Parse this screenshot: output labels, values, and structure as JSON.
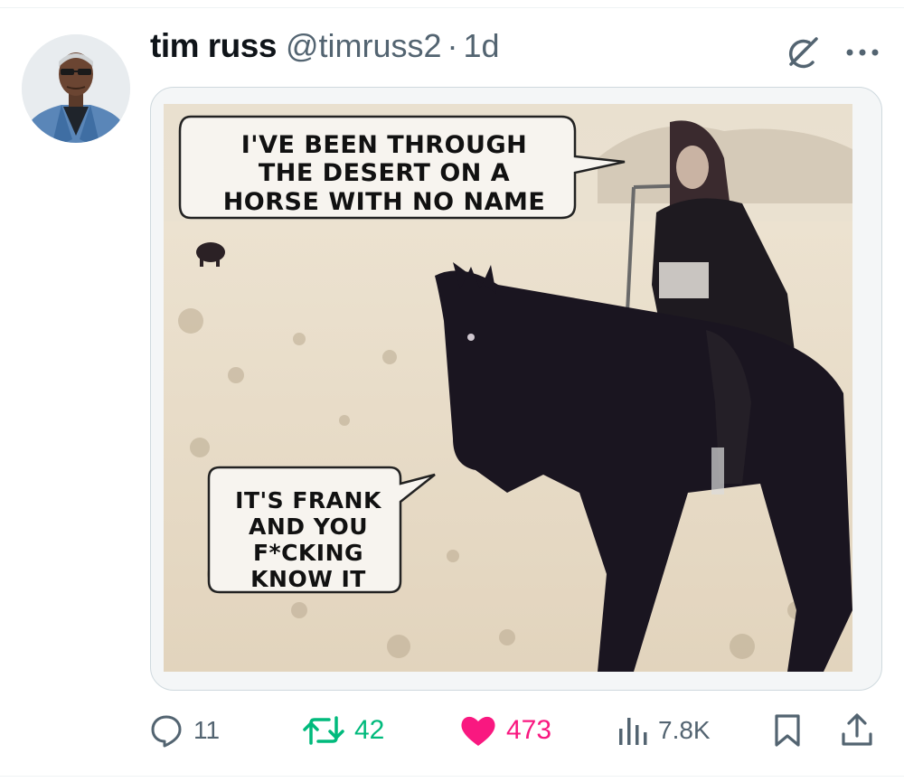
{
  "tweet": {
    "display_name": "tim russ",
    "handle": "@timruss2",
    "separator": "·",
    "time": "1d",
    "media": {
      "bubble_top_lines": [
        "I'VE BEEN THROUGH",
        "THE DESERT ON A",
        "HORSE WITH NO NAME"
      ],
      "bubble_bottom_lines": [
        "IT'S FRANK",
        "AND YOU",
        "F*CKING",
        "KNOW IT"
      ]
    }
  },
  "actions": {
    "reply_count": "11",
    "repost_count": "42",
    "like_count": "473",
    "views_count": "7.8K"
  },
  "colors": {
    "repost_green": "#00ba7c",
    "like_pink": "#f91880",
    "muted_gray": "#536471",
    "text_dark": "#0f1419"
  },
  "icons": [
    "grok-icon",
    "more-icon",
    "reply-icon",
    "repost-icon",
    "like-icon",
    "views-icon",
    "bookmark-icon",
    "share-icon"
  ]
}
